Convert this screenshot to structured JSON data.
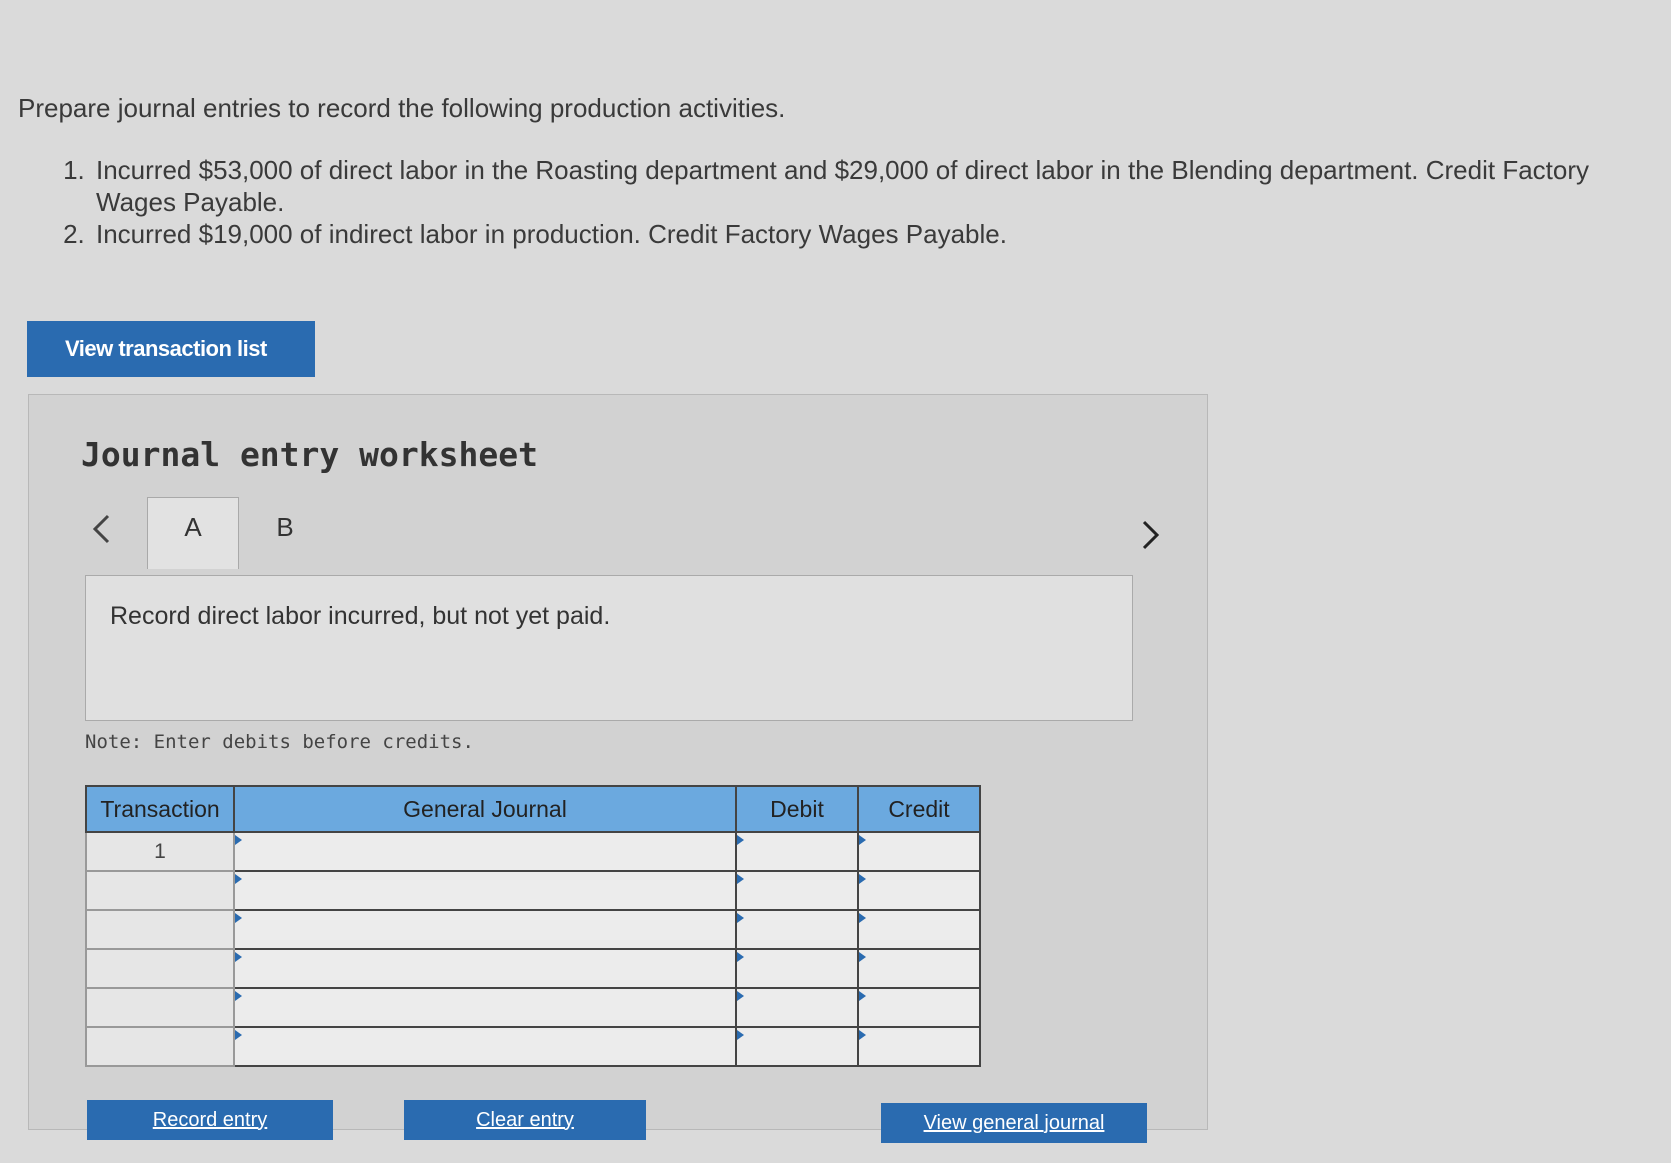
{
  "problem": {
    "intro": "Prepare journal entries to record the following production activities.",
    "items": [
      "Incurred $53,000 of direct labor in the Roasting department and $29,000 of direct labor in the Blending department. Credit Factory Wages Payable.",
      "Incurred $19,000 of indirect labor in production. Credit Factory Wages Payable."
    ]
  },
  "view_transaction_button": "View transaction list",
  "worksheet": {
    "title": "Journal entry worksheet",
    "tabs": [
      {
        "label": "A",
        "active": true
      },
      {
        "label": "B",
        "active": false
      }
    ],
    "prev_icon": "chevron-left-icon",
    "next_icon": "chevron-right-icon",
    "description": "Record direct labor incurred, but not yet paid.",
    "note": "Note: Enter debits before credits.",
    "table": {
      "headers": {
        "transaction": "Transaction",
        "general_journal": "General Journal",
        "debit": "Debit",
        "credit": "Credit"
      },
      "rows": [
        {
          "transaction": "1",
          "account": "",
          "debit": "",
          "credit": ""
        },
        {
          "transaction": "",
          "account": "",
          "debit": "",
          "credit": ""
        },
        {
          "transaction": "",
          "account": "",
          "debit": "",
          "credit": ""
        },
        {
          "transaction": "",
          "account": "",
          "debit": "",
          "credit": ""
        },
        {
          "transaction": "",
          "account": "",
          "debit": "",
          "credit": ""
        },
        {
          "transaction": "",
          "account": "",
          "debit": "",
          "credit": ""
        }
      ]
    },
    "buttons": {
      "record": "Record entry",
      "clear": "Clear entry",
      "view_journal": "View general journal"
    }
  },
  "colors": {
    "accent": "#2a6bb0",
    "header_blue": "#6ba9df",
    "background": "#dadada"
  }
}
